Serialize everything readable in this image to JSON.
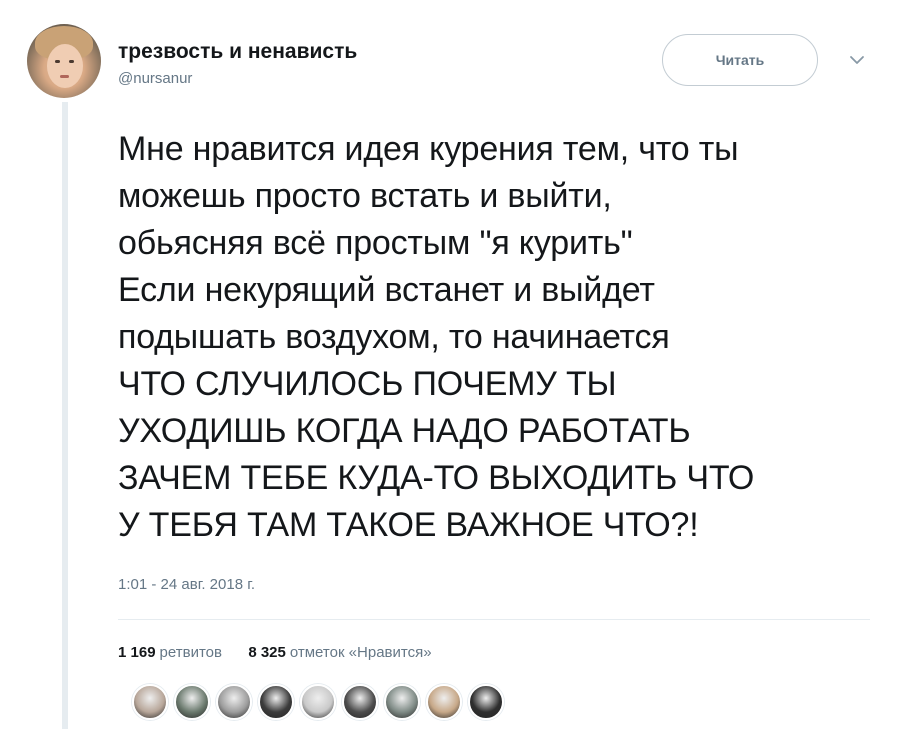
{
  "author": {
    "display_name": "трезвость и ненависть",
    "handle": "@nursanur",
    "avatar_icon": "child-photo-avatar"
  },
  "actions": {
    "follow_label": "Читать",
    "menu_icon": "chevron-down-icon"
  },
  "tweet": {
    "text": "Мне нравится идея курения тем, что ты\nможешь просто встать и выйти,\nобьясняя всё простым \"я курить\"\nЕсли некурящий встанет и выйдет\nподышать воздухом, то начинается\nЧТО СЛУЧИЛОСЬ ПОЧЕМУ ТЫ\nУХОДИШЬ КОГДА НАДО РАБОТАТЬ\nЗАЧЕМ ТЕБЕ КУДА-ТО ВЫХОДИТЬ ЧТО\nУ ТЕБЯ ТАМ ТАКОЕ ВАЖНОЕ ЧТО?!",
    "timestamp": "1:01 - 24 авг. 2018 г."
  },
  "stats": {
    "retweets_count": "1 169",
    "retweets_label": "ретвитов",
    "likes_count": "8 325",
    "likes_label": "отметок «Нравится»"
  },
  "likers": [
    {
      "icon": "liker-avatar-1",
      "color": "#b8a79a"
    },
    {
      "icon": "liker-avatar-2",
      "color": "#6b7a6e"
    },
    {
      "icon": "liker-avatar-3",
      "color": "#9d9d9d"
    },
    {
      "icon": "liker-avatar-4",
      "color": "#3c3c3c"
    },
    {
      "icon": "liker-avatar-5",
      "color": "#c9c9c9"
    },
    {
      "icon": "liker-avatar-6",
      "color": "#4d4d4d"
    },
    {
      "icon": "liker-avatar-7",
      "color": "#7f8b86"
    },
    {
      "icon": "liker-avatar-8",
      "color": "#c7a888"
    },
    {
      "icon": "liker-avatar-9",
      "color": "#2f2f2f"
    }
  ],
  "colors": {
    "text_primary": "#14171a",
    "text_secondary": "#657786",
    "border": "#e6ecf0"
  }
}
